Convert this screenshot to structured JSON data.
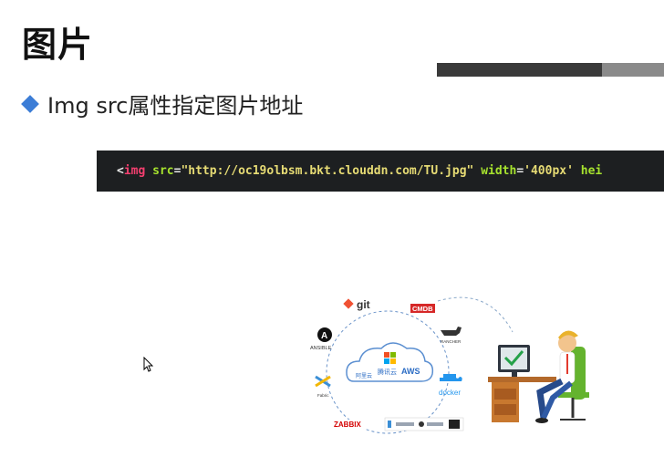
{
  "slide": {
    "title": "图片",
    "bullet": "Img src属性指定图片地址"
  },
  "code": {
    "open": "<",
    "tag": "img",
    "attr_src": "src",
    "eq1": "=",
    "src_value": "\"http://oc19olbsm.bkt.clouddn.com/TU.jpg\"",
    "attr_width": "width",
    "eq2": "=",
    "width_value": "'400px'",
    "trailing": "hei"
  },
  "illustration": {
    "git": "git",
    "cmdb": "CMDB",
    "ansible": "ANSIBLE",
    "rancher": "RANCHER",
    "fabric": "Fabric",
    "docker": "docker",
    "zabbix": "ZABBIX",
    "aliyun": "阿里云",
    "tencent": "腾讯云",
    "aws": "AWS"
  },
  "colors": {
    "accent_blue": "#3c7dd6",
    "code_bg": "#1d1f21",
    "tag_color": "#f43f6f",
    "attr_color": "#a6e22e",
    "string_color": "#e6db74"
  }
}
